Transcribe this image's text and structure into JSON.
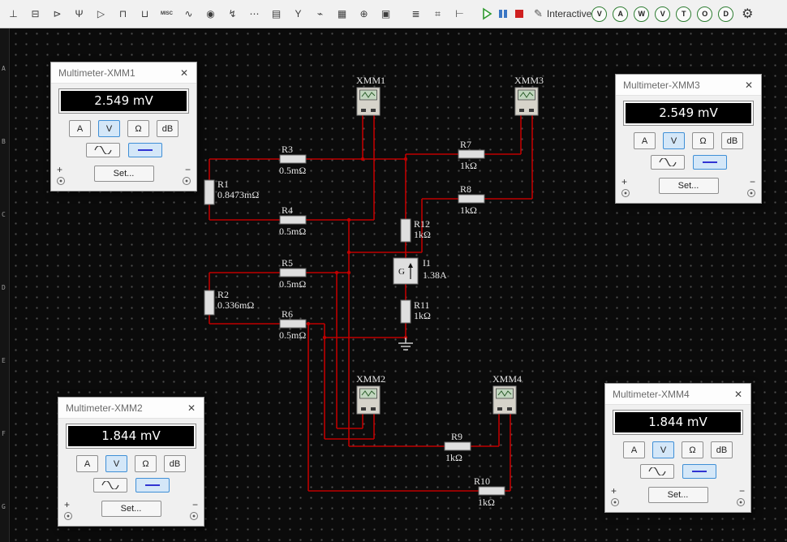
{
  "toolbar": {
    "component_icons": [
      {
        "name": "place-source",
        "glyph": "⊥"
      },
      {
        "name": "place-basic",
        "glyph": "⊟"
      },
      {
        "name": "place-diode",
        "glyph": "⊳"
      },
      {
        "name": "place-transistor",
        "glyph": "Ψ"
      },
      {
        "name": "place-analog",
        "glyph": "▷"
      },
      {
        "name": "place-ttl",
        "glyph": "⊓"
      },
      {
        "name": "place-cmos",
        "glyph": "⊔"
      },
      {
        "name": "place-misc-digital",
        "glyph": "MISC"
      },
      {
        "name": "place-mixed",
        "glyph": "∿"
      },
      {
        "name": "place-indicator",
        "glyph": "◉"
      },
      {
        "name": "place-power",
        "glyph": "↯"
      },
      {
        "name": "place-misc",
        "glyph": "⋯"
      },
      {
        "name": "place-advanced-peripherals",
        "glyph": "▤"
      },
      {
        "name": "place-rf",
        "glyph": "Y"
      },
      {
        "name": "place-electromechanical",
        "glyph": "⌁"
      },
      {
        "name": "place-ni-component",
        "glyph": "▦"
      },
      {
        "name": "place-connector",
        "glyph": "⊕"
      },
      {
        "name": "place-mcu",
        "glyph": "▣"
      }
    ],
    "edit_icons": [
      {
        "name": "ladder-diagram",
        "glyph": "≣"
      },
      {
        "name": "hierarchical-block",
        "glyph": "⌗"
      },
      {
        "name": "bus",
        "glyph": "⊢"
      }
    ],
    "interactive_label": "Interactive",
    "probe_icons": [
      {
        "name": "probe-voltage",
        "glyph": "V"
      },
      {
        "name": "probe-current",
        "glyph": "A"
      },
      {
        "name": "probe-power",
        "glyph": "W"
      },
      {
        "name": "probe-voltage-current",
        "glyph": "V"
      },
      {
        "name": "probe-voltage-ref",
        "glyph": "T"
      },
      {
        "name": "probe-oscilloscope",
        "glyph": "O"
      },
      {
        "name": "probe-digital",
        "glyph": "D"
      }
    ]
  },
  "canvas": {
    "sheet_rows": [
      "A",
      "B",
      "C",
      "D",
      "E",
      "F",
      "G"
    ],
    "resistors": [
      {
        "id": "R1",
        "value": "0.8473mΩ"
      },
      {
        "id": "R2",
        "value": "0.336mΩ"
      },
      {
        "id": "R3",
        "value": "0.5mΩ"
      },
      {
        "id": "R4",
        "value": "0.5mΩ"
      },
      {
        "id": "R5",
        "value": "0.5mΩ"
      },
      {
        "id": "R6",
        "value": "0.5mΩ"
      },
      {
        "id": "R7",
        "value": "1kΩ"
      },
      {
        "id": "R8",
        "value": "1kΩ"
      },
      {
        "id": "R9",
        "value": "1kΩ"
      },
      {
        "id": "R10",
        "value": "1kΩ"
      },
      {
        "id": "R11",
        "value": "1kΩ"
      },
      {
        "id": "R12",
        "value": "1kΩ"
      }
    ],
    "meters": [
      {
        "id": "XMM1"
      },
      {
        "id": "XMM3"
      },
      {
        "id": "XMM2"
      },
      {
        "id": "XMM4"
      }
    ],
    "source": {
      "id": "I1",
      "value": "1.38A",
      "symbol": "G"
    }
  },
  "windows": [
    {
      "title": "Multimeter-XMM1",
      "value": "2.549 mV"
    },
    {
      "title": "Multimeter-XMM3",
      "value": "2.549 mV"
    },
    {
      "title": "Multimeter-XMM2",
      "value": "1.844 mV"
    },
    {
      "title": "Multimeter-XMM4",
      "value": "1.844 mV"
    }
  ],
  "meter_ui": {
    "mode_a": "A",
    "mode_v": "V",
    "mode_ohm": "Ω",
    "mode_db": "dB",
    "set_label": "Set...",
    "plus": "+",
    "minus": "−",
    "close": "✕"
  }
}
